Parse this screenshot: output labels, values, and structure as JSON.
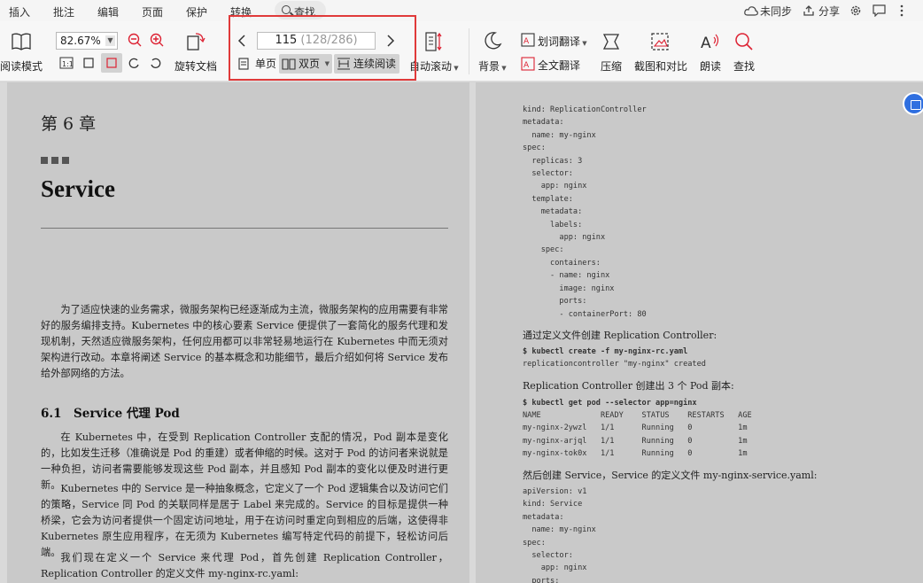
{
  "menu": {
    "items": [
      "插入",
      "批注",
      "编辑",
      "页面",
      "保护",
      "转换"
    ],
    "search_label": "查找",
    "sync_label": "未同步",
    "share_label": "分享"
  },
  "toolbar": {
    "read_mode": "阅读模式",
    "zoom_value": "82.67%",
    "rotate_doc": "旋转文档",
    "page_current": "115",
    "page_total": "(128/286)",
    "single_page": "单页",
    "double_page": "双页",
    "continuous_read": "连续阅读",
    "auto_scroll": "自动滚动",
    "background": "背景",
    "word_translate": "划词翻译",
    "full_translate": "全文翻译",
    "compress": "压缩",
    "screenshot_compare": "截图和对比",
    "read_aloud": "朗读",
    "find": "查找"
  },
  "left_page": {
    "chapter": "第 6 章",
    "title": "Service",
    "intro": "为了适应快速的业务需求，微服务架构已经逐渐成为主流，微服务架构的应用需要有非常好的服务编排支持。Kubernetes 中的核心要素 Service 便提供了一套简化的服务代理和发现机制，天然适应微服务架构，任何应用都可以非常轻易地运行在 Kubernetes 中而无须对架构进行改动。本章将阐述 Service 的基本概念和功能细节，最后介绍如何将 Service 发布给外部网络的方法。",
    "section": "6.1　Service 代理 Pod",
    "p1": "在 Kubernetes 中，在受到 Replication Controller 支配的情况，Pod 副本是变化的，比如发生迁移（准确说是 Pod 的重建）或者伸缩的时候。这对于 Pod 的访问者来说就是一种负担，访问者需要能够发现这些 Pod 副本，并且感知 Pod 副本的变化以便及时进行更新。",
    "p2": "Kubernetes 中的 Service 是一种抽象概念，它定义了一个 Pod 逻辑集合以及访问它们的策略，Service 同 Pod 的关联同样是居于 Label 来完成的。Service 的目标是提供一种桥梁，它会为访问者提供一个固定访问地址，用于在访问时重定向到相应的后端，这使得非 Kubernetes 原生应用程序，在无须为 Kubernetes 编写特定代码的前提下，轻松访问后端。",
    "p3": "我们现在定义一个 Service 来代理 Pod，首先创建 Replication Controller，Replication Controller 的定义文件 my-nginx-rc.yaml:"
  },
  "right_page": {
    "code1": "kind: ReplicationController\nmetadata:\n  name: my-nginx\nspec:\n  replicas: 3\n  selector:\n    app: nginx\n  template:\n    metadata:\n      labels:\n        app: nginx\n    spec:\n      containers:\n      - name: nginx\n        image: nginx\n        ports:\n        - containerPort: 80",
    "text1": "通过定义文件创建 Replication Controller:",
    "cmd1": "$ kubectl create -f my-nginx-rc.yaml",
    "out1": "replicationcontroller \"my-nginx\" created",
    "text2": "Replication Controller 创建出 3 个 Pod 副本:",
    "cmd2": "$ kubectl get pod --selector app=nginx",
    "out2": "NAME             READY    STATUS    RESTARTS   AGE\nmy-nginx-2ywzl   1/1      Running   0          1m\nmy-nginx-arjql   1/1      Running   0          1m\nmy-nginx-tok0x   1/1      Running   0          1m",
    "text3": "然后创建 Service，Service 的定义文件 my-nginx-service.yaml:",
    "code2": "apiVersion: v1\nkind: Service\nmetadata:\n  name: my-nginx\nspec:\n  selector:\n    app: nginx\n  ports:"
  }
}
